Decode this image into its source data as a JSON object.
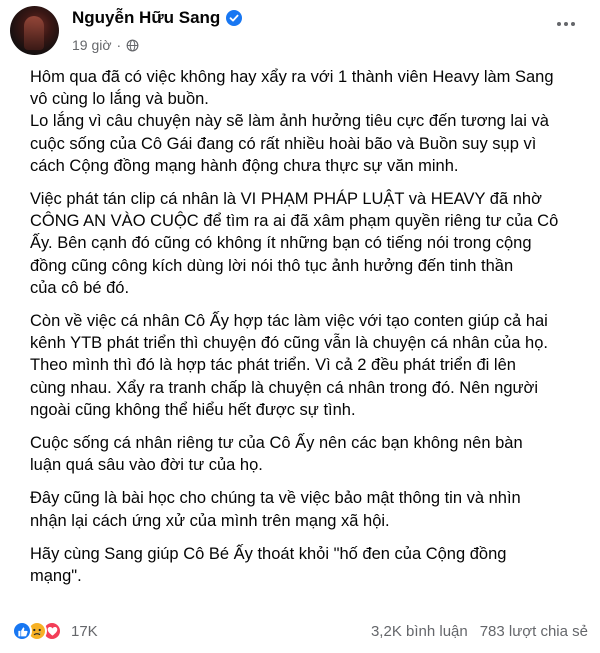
{
  "post": {
    "author": "Nguyễn Hữu Sang",
    "time": "19 giờ",
    "separator": "·",
    "verified_icon": "verified-badge-icon",
    "audience_icon": "globe-icon"
  },
  "body": {
    "p1": [
      "Hôm qua đã có việc không hay xẩy ra với 1 thành viên Heavy làm Sang",
      "vô cùng lo lắng và buồn.",
      "Lo lắng vì câu chuyện này sẽ làm ảnh hưởng tiêu cực đến tương lai và",
      "cuộc sống của Cô Gái đang có rất nhiều hoài bão và Buồn suy sụp vì",
      "cách Cộng đồng mạng hành động chưa thực sự văn minh."
    ],
    "p2": [
      "Việc phát tán clip cá nhân là VI PHẠM PHÁP LUẬT và HEAVY đã nhờ",
      "CÔNG AN VÀO CUỘC để tìm ra ai đã xâm phạm quyền riêng tư của Cô",
      "Ấy. Bên cạnh đó cũng có không ít những bạn có tiếng nói trong cộng",
      "đồng cũng công kích dùng lời nói thô tục ảnh hưởng đến tinh thần",
      "của cô bé đó."
    ],
    "p3": [
      "Còn về việc cá nhân Cô Ấy hợp tác làm việc với tạo conten giúp cả hai",
      "kênh YTB phát triển thì chuyện đó cũng vẫn là chuyện cá nhân của họ.",
      "Theo mình thì đó là hợp tác phát triển. Vì cả 2 đều phát triển đi lên",
      "cùng nhau. Xẩy ra tranh chấp là chuyện cá nhân trong đó. Nên người",
      "ngoài cũng không thể hiểu hết được sự tình."
    ],
    "p4": [
      "Cuộc sống cá nhân riêng tư của Cô Ấy nên các bạn không nên bàn",
      "luận quá sâu vào đời tư của họ."
    ],
    "p5": [
      "Đây cũng là bài học cho chúng ta về việc bảo mật thông tin và nhìn",
      "nhận lại cách ứng xử của mình trên mạng xã hội."
    ],
    "p6": [
      "Hãy cùng Sang giúp Cô Bé Ấy thoát khỏi \"hố đen của Cộng đồng",
      "mạng\"."
    ]
  },
  "footer": {
    "reaction_icons": [
      "like-icon",
      "sad-icon",
      "love-icon"
    ],
    "reaction_count": "17K",
    "comments": "3,2K bình luận",
    "shares": "783 lượt chia sẻ"
  },
  "colors": {
    "brand_blue": "#1877f2",
    "secondary_text": "#65676b",
    "sad_yellow": "#f7b125",
    "love_red": "#f33e58"
  }
}
